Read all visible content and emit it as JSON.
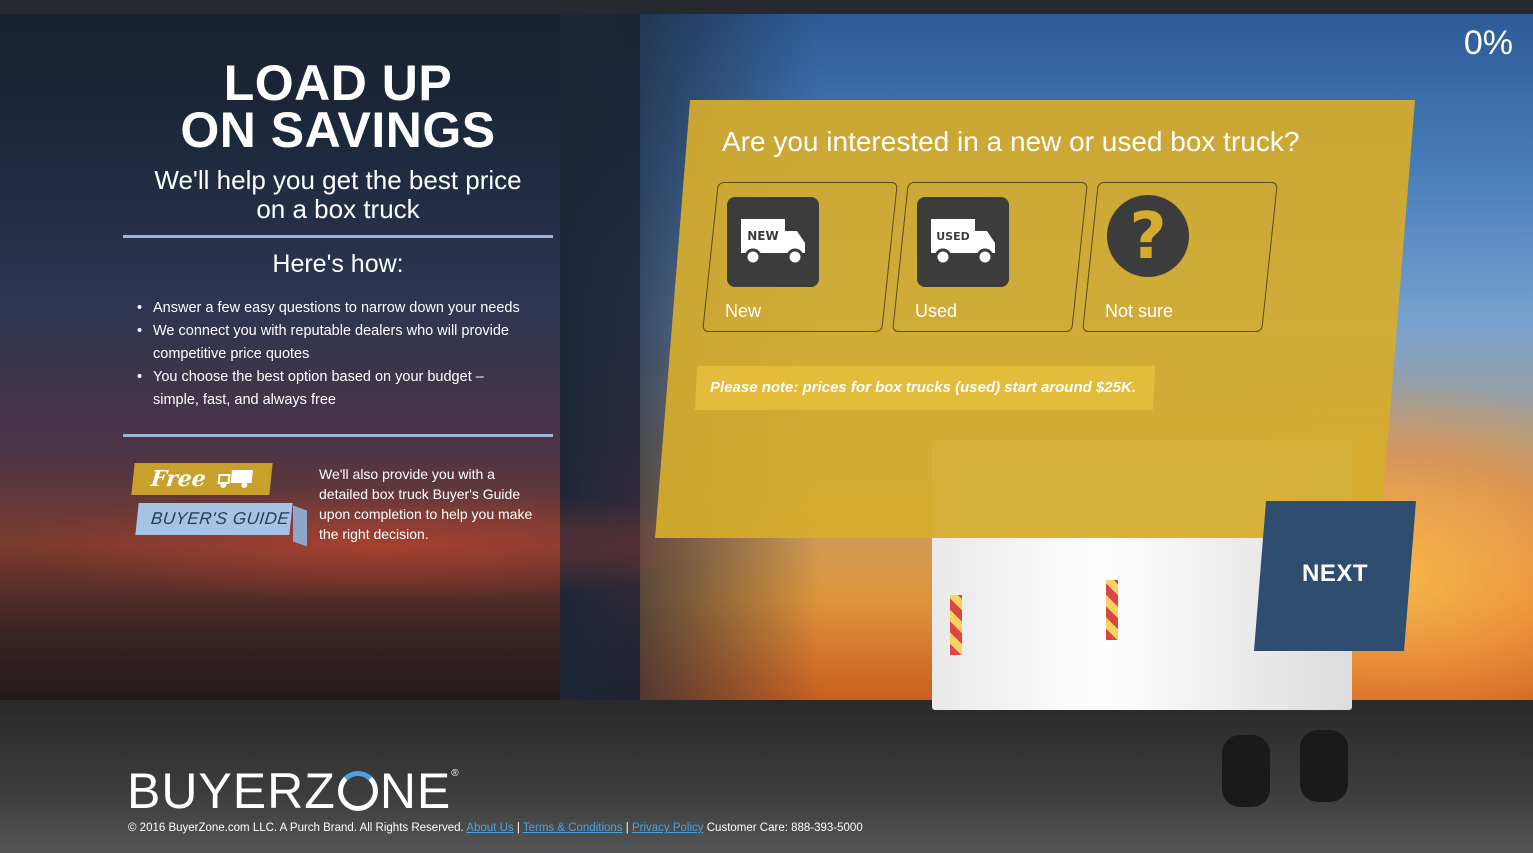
{
  "progress": {
    "percent_label": "0%",
    "value": 0
  },
  "left": {
    "headline_line1": "LOAD UP",
    "headline_line2": "ON SAVINGS",
    "subhead_line1": "We'll help you get the best price",
    "subhead_line2": "on a box truck",
    "howto_title": "Here's how:",
    "steps": [
      "Answer a few easy questions to narrow down your needs",
      "We connect you with reputable dealers who will provide competitive price quotes",
      "You choose the best option based on your budget – simple, fast, and always free"
    ]
  },
  "guide": {
    "free_label": "Free",
    "guide_label": "BUYER'S GUIDE",
    "description": "We'll also provide you with a detailed box truck Buyer's Guide upon completion to help you make the right decision."
  },
  "question": {
    "text": "Are you interested in a new or used box truck?",
    "options": [
      {
        "label": "New",
        "icon": "new-truck-icon",
        "badge": "NEW"
      },
      {
        "label": "Used",
        "icon": "used-truck-icon",
        "badge": "USED"
      },
      {
        "label": "Not sure",
        "icon": "question-mark-icon",
        "badge": "?"
      }
    ],
    "note": "Please note: prices for box trucks (used) start around $25K."
  },
  "next_label": "NEXT",
  "footer": {
    "logo_left": "BUYERZ",
    "logo_right": "NE",
    "copyright": "© 2016 BuyerZone.com LLC. A Purch Brand. All Rights Reserved.",
    "about": "About Us",
    "terms": "Terms & Conditions",
    "privacy": "Privacy Policy",
    "care": "Customer Care: 888-393-5000",
    "sep": "|"
  },
  "colors": {
    "card": "#d6ac2c",
    "next": "#2f4d6e",
    "divider": "#9db6d6",
    "link": "#4aa3df"
  }
}
